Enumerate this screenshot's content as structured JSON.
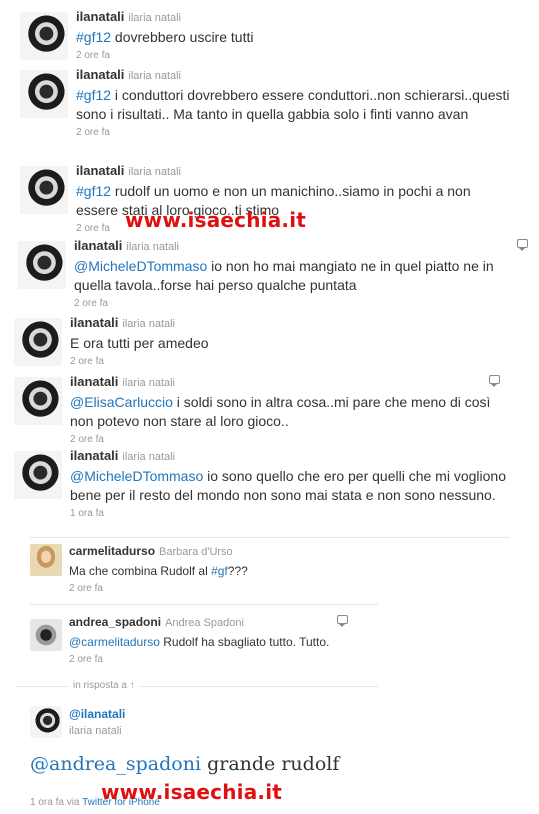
{
  "tweets": [
    {
      "screen_name": "ilanatali",
      "full_name": "ilaria natali",
      "time": "2 ore fa",
      "parts": [
        {
          "t": "#gf12",
          "link": true
        },
        {
          "t": " dovrebbero uscire tutti",
          "link": false
        }
      ]
    },
    {
      "screen_name": "ilanatali",
      "full_name": "ilaria natali",
      "time": "2 ore fa",
      "parts": [
        {
          "t": "#gf12",
          "link": true
        },
        {
          "t": " i conduttori dovrebbero essere conduttori..non schierarsi..questi sono i risultati.. Ma tanto in quella gabbia solo i finti vanno avan",
          "link": false
        }
      ]
    },
    {
      "screen_name": "ilanatali",
      "full_name": "ilaria natali",
      "time": "2 ore fa",
      "parts": [
        {
          "t": "#gf12",
          "link": true
        },
        {
          "t": " rudolf un uomo e non un manichino..siamo in pochi a non essere stati al loro gioco..ti stimo",
          "link": false
        }
      ]
    },
    {
      "screen_name": "ilanatali",
      "full_name": "ilaria natali",
      "time": "2 ore fa",
      "parts": [
        {
          "t": "@MicheleDTommaso",
          "link": true
        },
        {
          "t": " io non ho mai mangiato ne in quel piatto ne in quella tavola..forse hai perso qualche puntata",
          "link": false
        }
      ]
    },
    {
      "screen_name": "ilanatali",
      "full_name": "ilaria natali",
      "time": "2 ore fa",
      "parts": [
        {
          "t": "E ora tutti per amedeo",
          "link": false
        }
      ]
    },
    {
      "screen_name": "ilanatali",
      "full_name": "ilaria natali",
      "time": "2 ore fa",
      "parts": [
        {
          "t": "@ElisaCarluccio",
          "link": true
        },
        {
          "t": " i soldi sono in altra cosa..mi pare che meno di così non potevo non stare al loro gioco..",
          "link": false
        }
      ]
    },
    {
      "screen_name": "ilanatali",
      "full_name": "ilaria natali",
      "time": "1 ora fa",
      "parts": [
        {
          "t": "@MicheleDTommaso",
          "link": true
        },
        {
          "t": " io sono quello che ero per quelli che mi vogliono bene per il resto del mondo non sono mai stata e non sono nessuno.",
          "link": false
        }
      ]
    },
    {
      "screen_name": "carmelitadurso",
      "full_name": "Barbara d'Urso",
      "time": "2 ore fa",
      "parts": [
        {
          "t": "Ma che combina Rudolf al ",
          "link": false
        },
        {
          "t": "#gf",
          "link": true
        },
        {
          "t": "???",
          "link": false
        }
      ]
    },
    {
      "screen_name": "andrea_spadoni",
      "full_name": "Andrea Spadoni",
      "time": "2 ore fa",
      "parts": [
        {
          "t": "@carmelitadurso",
          "link": true
        },
        {
          "t": " Rudolf ha sbagliato tutto. Tutto.",
          "link": false
        }
      ]
    }
  ],
  "in_reply_label": "in risposta a ↑",
  "main": {
    "screen_name": "@ilanatali",
    "full_name": "ilaria natali",
    "mention": "@andrea_spadoni",
    "text": " grande rudolf",
    "time": "1 ora fa",
    "via": "via",
    "client": "Twitter for iPhone"
  },
  "watermark": "www.isaechia.it",
  "colors": {
    "link": "#2276bb",
    "watermark": "#e01010"
  }
}
